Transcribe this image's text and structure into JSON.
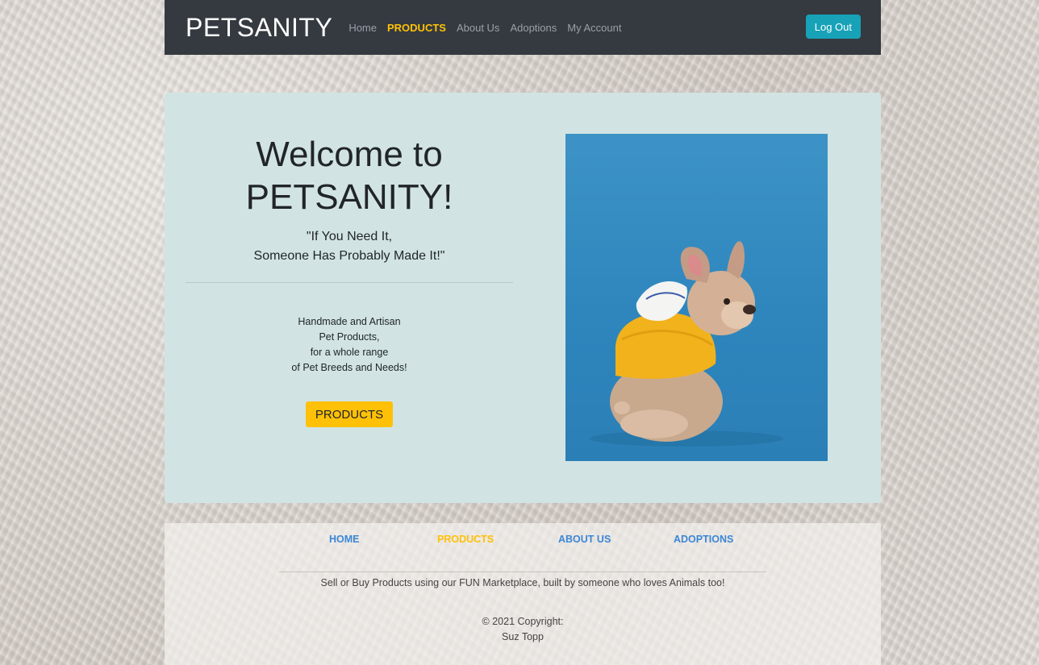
{
  "navbar": {
    "brand": "PETSANITY",
    "links": [
      {
        "label": "Home",
        "active": false
      },
      {
        "label": "PRODUCTS",
        "active": true
      },
      {
        "label": "About Us",
        "active": false
      },
      {
        "label": "Adoptions",
        "active": false
      },
      {
        "label": "My Account",
        "active": false
      }
    ],
    "logout_label": "Log Out"
  },
  "hero": {
    "title_line1": "Welcome to",
    "title_line2": "PETSANITY!",
    "quote": "\"If You Need It,\nSomeone Has Probably Made It!\"",
    "description": "Handmade and Artisan\nPet Products,\nfor a whole range\nof Pet Breeds and Needs!",
    "button_label": "PRODUCTS",
    "image_subject": "french-bulldog-in-yellow-hoodie"
  },
  "footer": {
    "links": [
      {
        "label": "HOME",
        "active": false
      },
      {
        "label": "PRODUCTS",
        "active": true
      },
      {
        "label": "ABOUT US",
        "active": false
      },
      {
        "label": "ADOPTIONS",
        "active": false
      }
    ],
    "tagline": "Sell or Buy Products using our FUN Marketplace, built by someone who loves Animals too!",
    "copyright": "© 2021 Copyright:\nSuz Topp"
  },
  "colors": {
    "navbar_bg": "#343a40",
    "accent_yellow": "#ffc107",
    "logout_teal": "#17a2b8",
    "hero_bg": "#d1e4e3",
    "footer_link_blue": "#3b87d6"
  }
}
